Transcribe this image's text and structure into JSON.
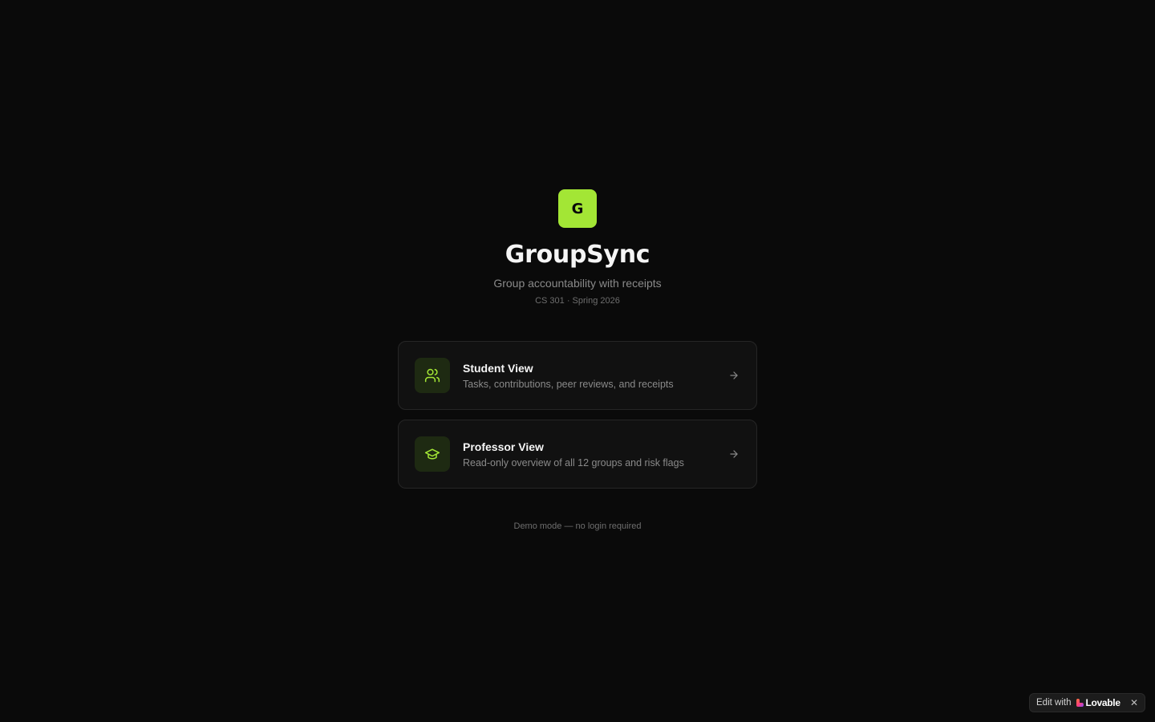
{
  "app": {
    "logo_letter": "G",
    "title": "GroupSync",
    "tagline": "Group accountability with receipts",
    "course": "CS 301 · Spring 2026"
  },
  "views": [
    {
      "title": "Student View",
      "description": "Tasks, contributions, peer reviews, and receipts",
      "icon": "users-icon"
    },
    {
      "title": "Professor View",
      "description": "Read-only overview of all 12 groups and risk flags",
      "icon": "graduation-cap-icon"
    }
  ],
  "footer": {
    "note": "Demo mode — no login required"
  },
  "badge": {
    "edit_label": "Edit with",
    "brand": "Lovable",
    "close": "✕"
  },
  "colors": {
    "background": "#0a0a0a",
    "accent": "#a3e635",
    "card_bg": "#111111",
    "card_border": "#262626",
    "icon_tile_bg": "#1e2a12",
    "muted_text": "#8a8a8a"
  }
}
